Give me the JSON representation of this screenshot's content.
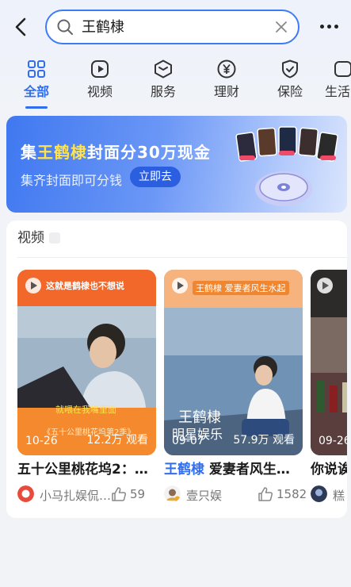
{
  "search": {
    "query": "王鹤棣"
  },
  "tabs": [
    {
      "label": "全部",
      "icon": "grid-icon",
      "active": true
    },
    {
      "label": "视频",
      "icon": "play-icon"
    },
    {
      "label": "服务",
      "icon": "service-cube-icon"
    },
    {
      "label": "理财",
      "icon": "yen-icon"
    },
    {
      "label": "保险",
      "icon": "shield-check-icon"
    },
    {
      "label": "生活",
      "icon": "life-icon"
    }
  ],
  "banner": {
    "title_prefix": "集",
    "title_highlight": "王鹤棣",
    "title_suffix": "封面分30万现金",
    "subtitle": "集齐封面即可分钱",
    "button": "立即去"
  },
  "videos_section": {
    "title": "视频",
    "cards": [
      {
        "date": "10-26",
        "views": "12.2万 观看",
        "title": "五十公里桃花坞2：…",
        "title_keyword": "",
        "author": "小马扎娱侃…",
        "likes": "59",
        "thumb_caption": "这就是鹤棣也不想说",
        "thumb_subtitle": "就喂在我嘴里面",
        "thumb_tag": "《五十公里桃花坞第2季》"
      },
      {
        "date": "09-07",
        "views": "57.9万 观看",
        "title_keyword": "王鹤棣",
        "title": " 爱妻者风生…",
        "author": "壹只娱",
        "likes": "1582",
        "thumb_caption": "王鹤棣 爱妻者风生水起",
        "thumb_overlay1": "王鹤棣",
        "thumb_overlay2": "明星娱乐"
      },
      {
        "date": "09-26",
        "views": "",
        "title": "你说诶",
        "title_keyword": "",
        "author": "糕",
        "likes": ""
      }
    ]
  },
  "colors": {
    "accent": "#2f6ef2",
    "highlight": "#ffe34d"
  }
}
